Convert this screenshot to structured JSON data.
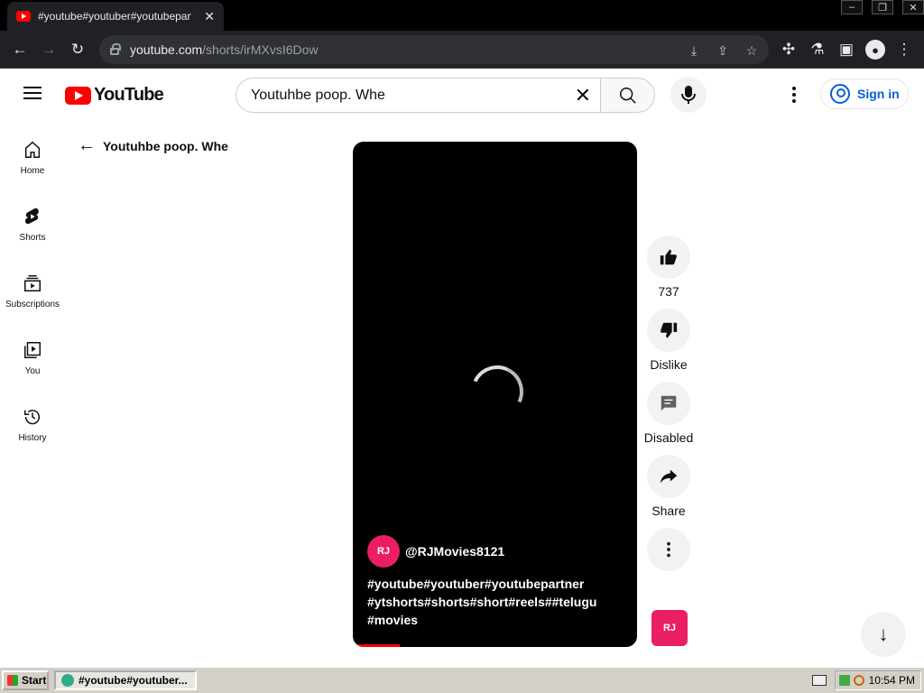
{
  "browser": {
    "tab_title": "#youtube#youtuber#youtubepartne",
    "url_host": "youtube.com",
    "url_path": "/shorts/irMXvsI6Dow"
  },
  "youtube": {
    "logo_text": "YouTube",
    "search_value": "Youtuhbe poop. Whe",
    "sign_in": "Sign in",
    "guide": [
      {
        "label": "Home",
        "icon": "home-icon"
      },
      {
        "label": "Shorts",
        "icon": "shorts-icon"
      },
      {
        "label": "Subscriptions",
        "icon": "subscriptions-icon"
      },
      {
        "label": "You",
        "icon": "you-icon"
      },
      {
        "label": "History",
        "icon": "history-icon"
      }
    ],
    "back_title": "Youtuhbe poop. Whe",
    "channel_name": "@RJMovies8121",
    "channel_avatar_text": "RJ",
    "description": "#youtube#youtuber#youtubepartner #ytshorts#shorts#short#reels##telugu #movies",
    "actions": {
      "like_count": "737",
      "dislike_label": "Dislike",
      "comments_label": "Disabled",
      "share_label": "Share"
    }
  },
  "taskbar": {
    "start_label": "Start",
    "task_label": "#youtube#youtuber...",
    "clock": "10:54 PM"
  },
  "colors": {
    "brand_red": "#ff0000",
    "link_blue": "#065fd4",
    "browser_dark": "#202124"
  }
}
